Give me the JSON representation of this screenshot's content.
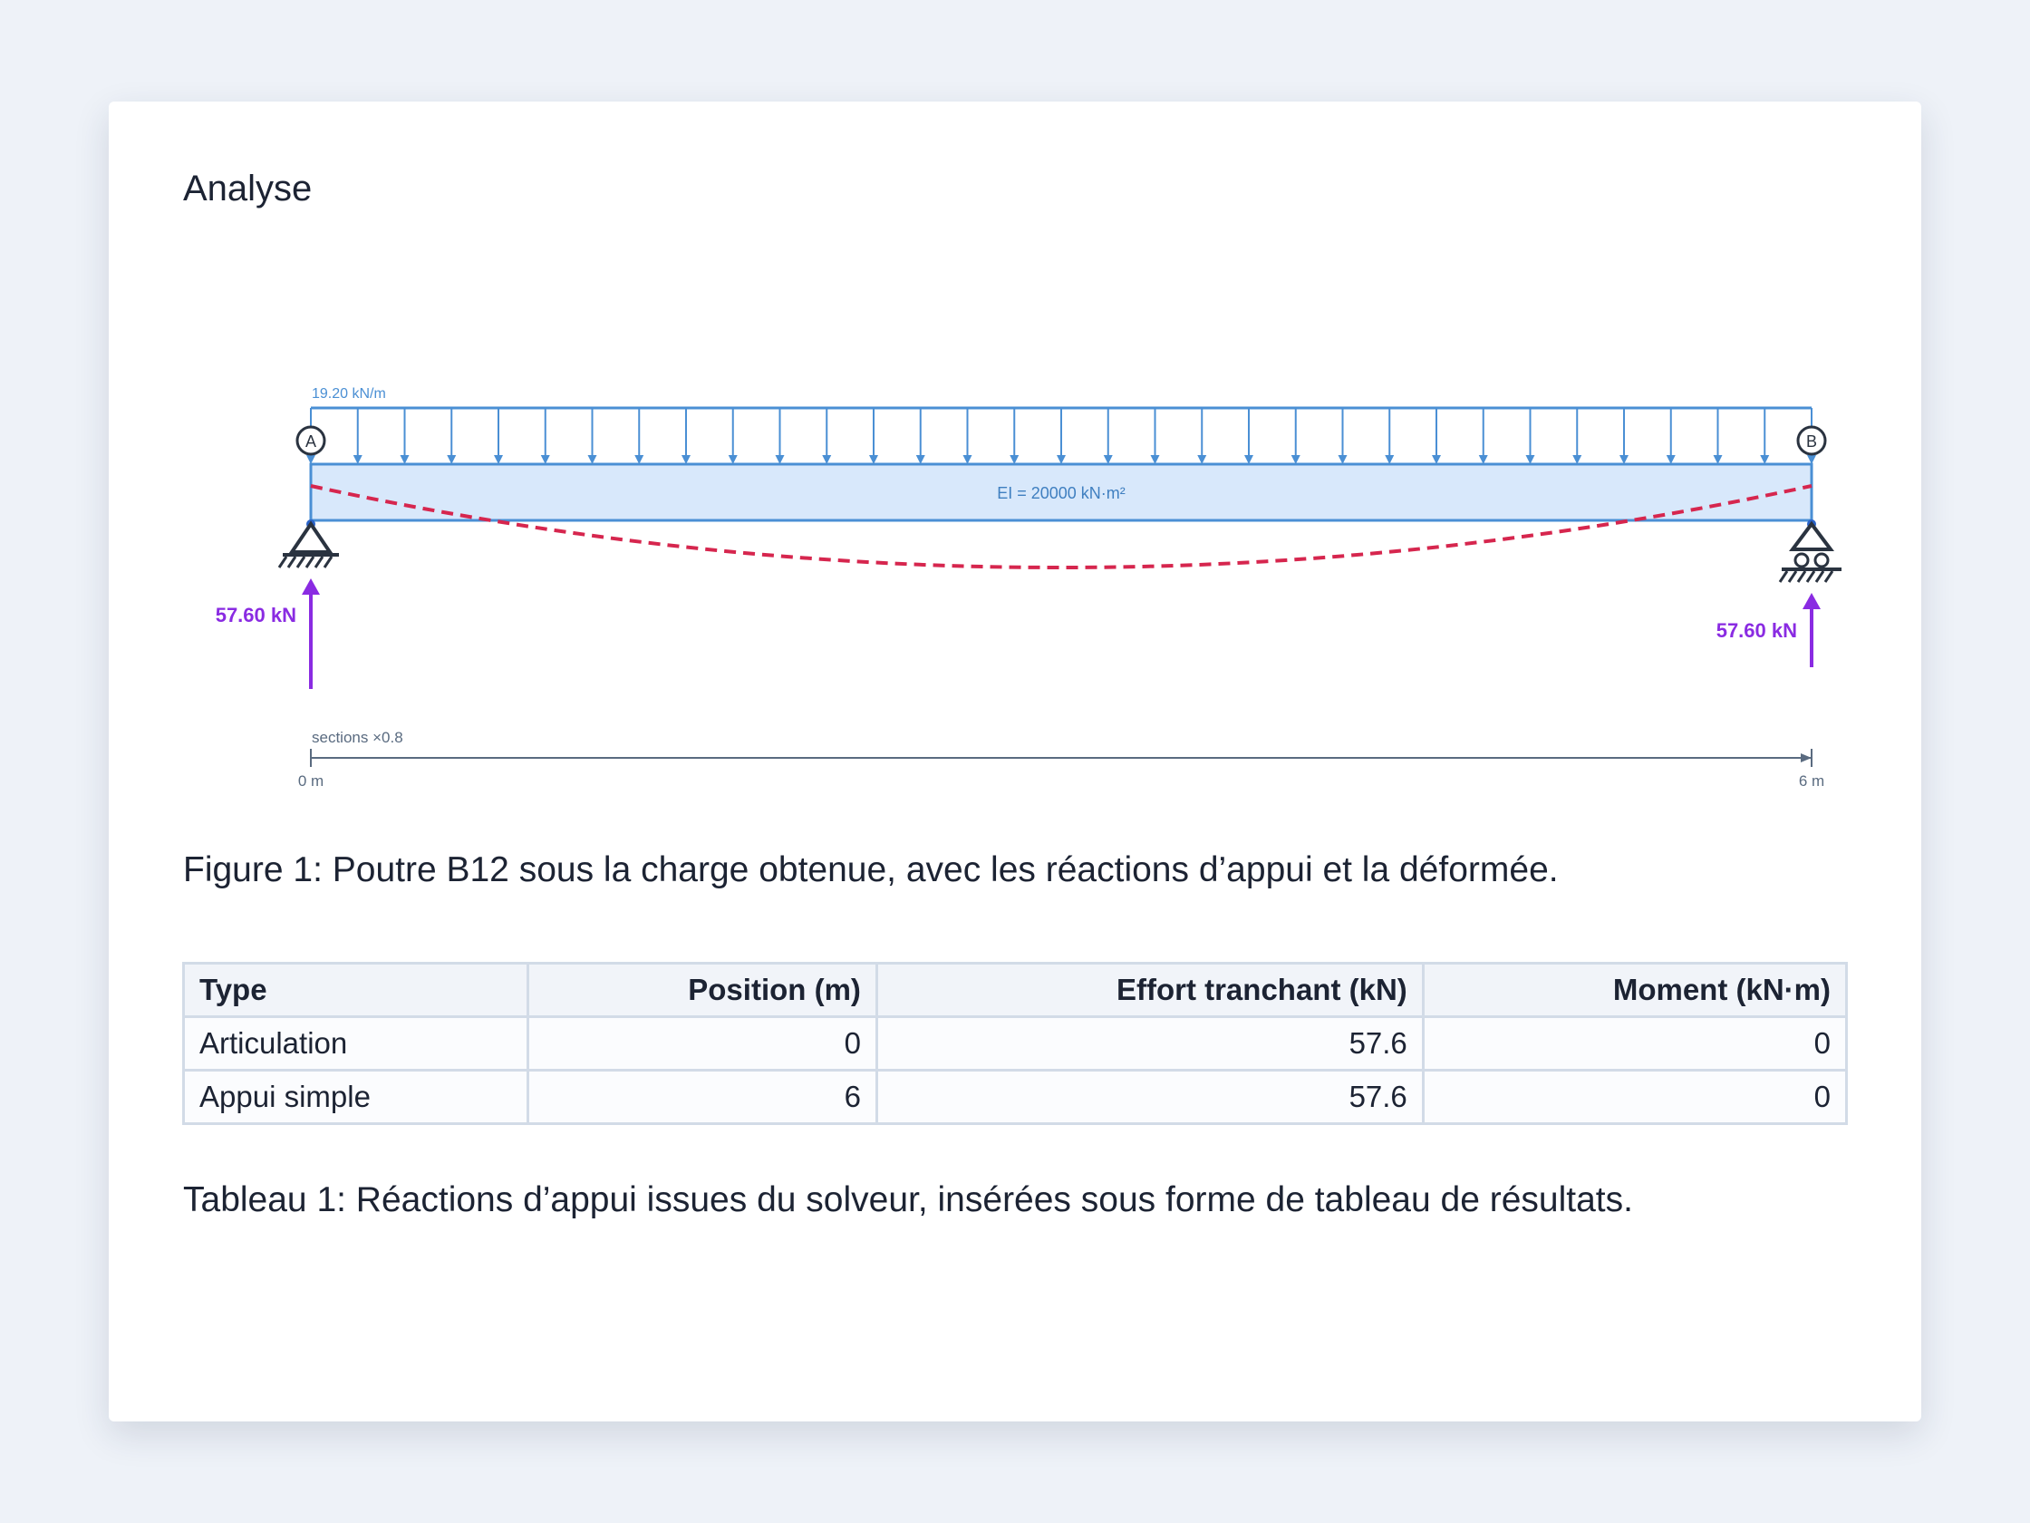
{
  "section_title": "Analyse",
  "diagram": {
    "load_label": "19.20 kN/m",
    "stiffness_label": "EI = 20000 kN·m²",
    "node_a": "A",
    "node_b": "B",
    "reaction_a": "57.60 kN",
    "reaction_b": "57.60 kN",
    "scale_label": "sections ×0.8",
    "axis_start": "0 m",
    "axis_end": "6 m",
    "colors": {
      "load": "#4a8fd4",
      "beam_fill": "#d8e8fb",
      "deflection": "#d6264e",
      "reaction": "#8a2be2",
      "support": "#2a3340",
      "axis": "#5a6b80"
    }
  },
  "figure_caption": "Figure 1: Poutre B12 sous la charge obtenue, avec les réactions d’appui et la déformée.",
  "table": {
    "headers": [
      "Type",
      "Position (m)",
      "Effort tranchant (kN)",
      "Moment (kN·m)"
    ],
    "rows": [
      [
        "Articulation",
        "0",
        "57.6",
        "0"
      ],
      [
        "Appui simple",
        "6",
        "57.6",
        "0"
      ]
    ]
  },
  "table_caption": "Tableau 1: Réactions d’appui issues du solveur, insérées sous forme de tableau de résultats."
}
